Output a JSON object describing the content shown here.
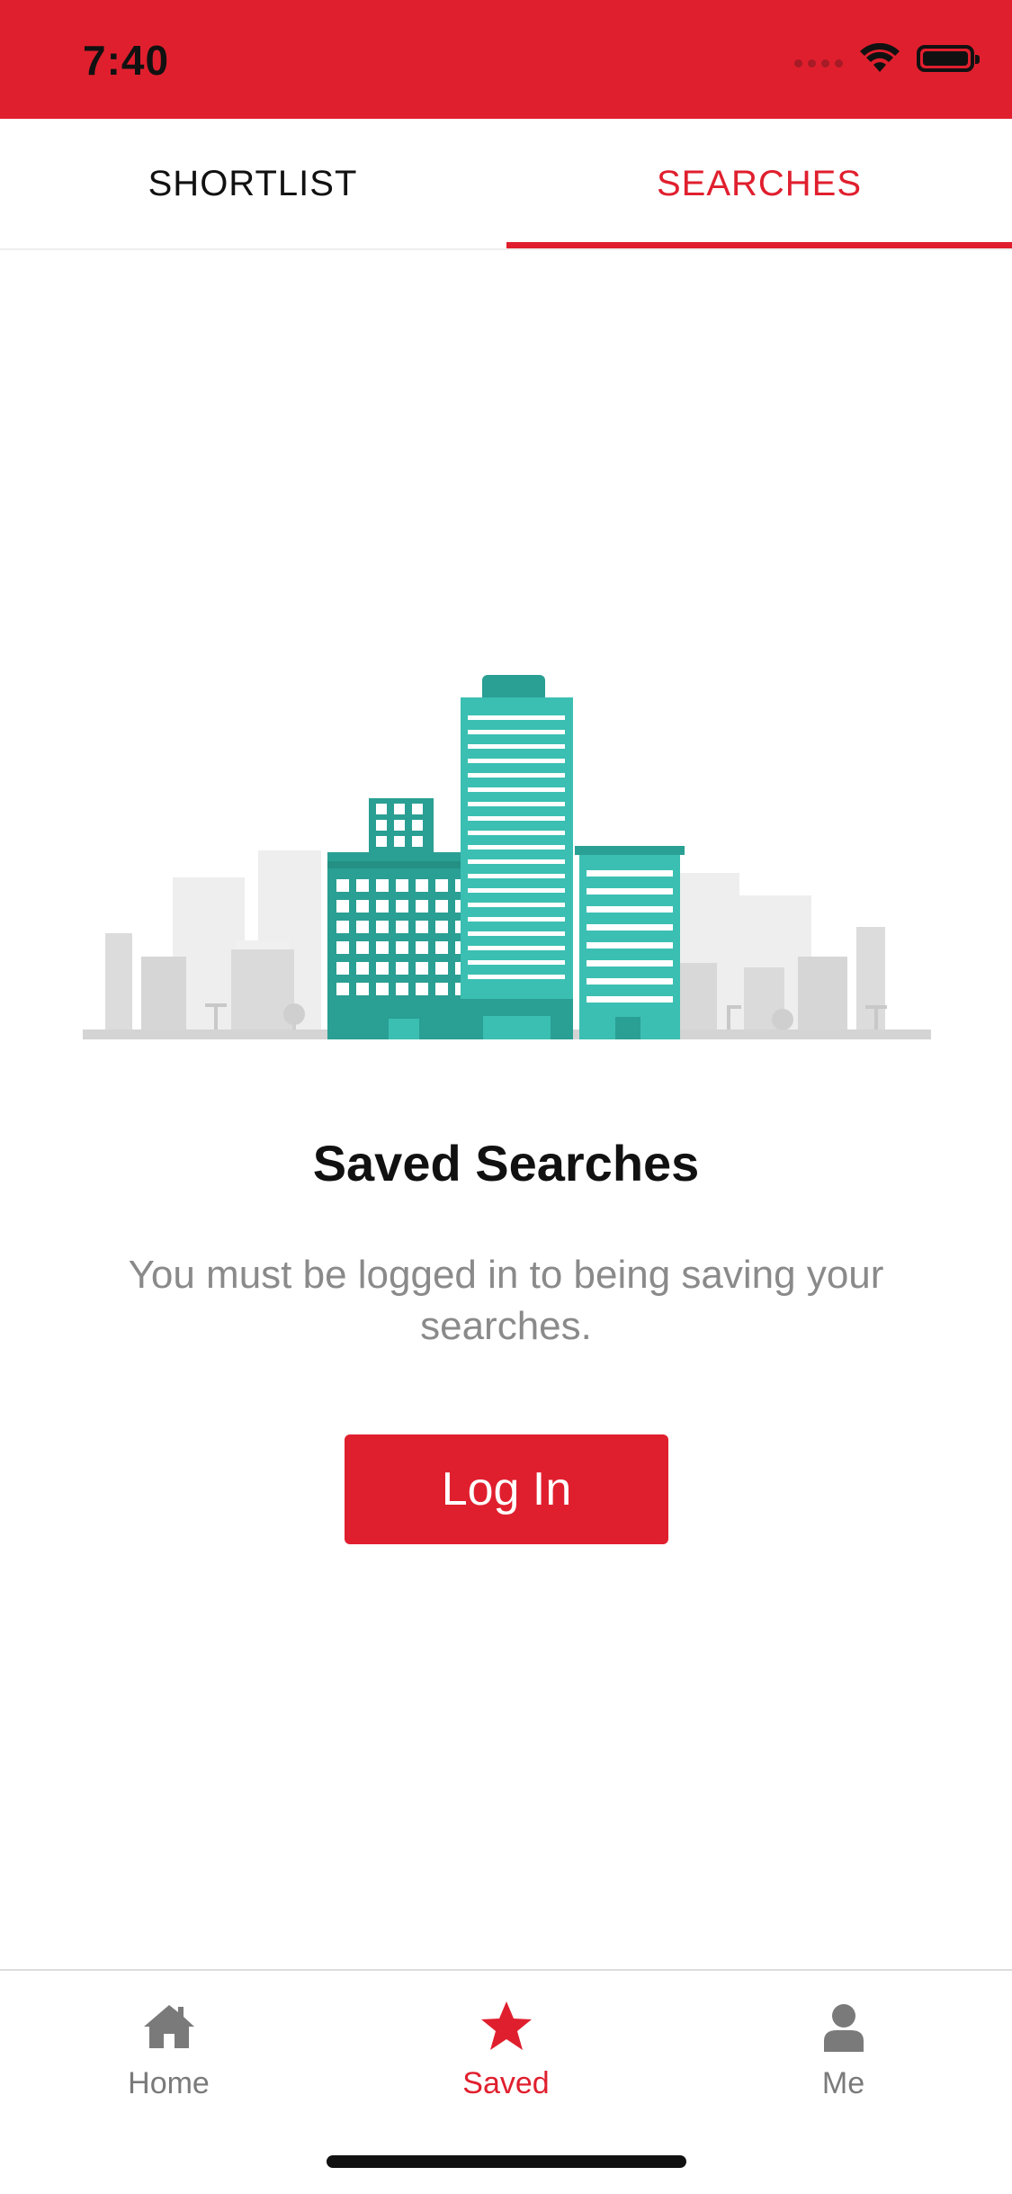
{
  "status_bar": {
    "time": "7:40"
  },
  "tabs": [
    {
      "label": "SHORTLIST",
      "active": false
    },
    {
      "label": "SEARCHES",
      "active": true
    }
  ],
  "empty_state": {
    "title": "Saved Searches",
    "message": "You must be logged in to being saving your searches.",
    "button_label": "Log In"
  },
  "bottom_nav": [
    {
      "label": "Home",
      "icon": "home-icon",
      "active": false
    },
    {
      "label": "Saved",
      "icon": "star-icon",
      "active": true
    },
    {
      "label": "Me",
      "icon": "person-icon",
      "active": false
    }
  ],
  "colors": {
    "brand_red": "#E01F2E",
    "teal": "#3BBFB2",
    "teal_dark": "#2A9F93",
    "muted_gray": "#8a8a8a"
  }
}
